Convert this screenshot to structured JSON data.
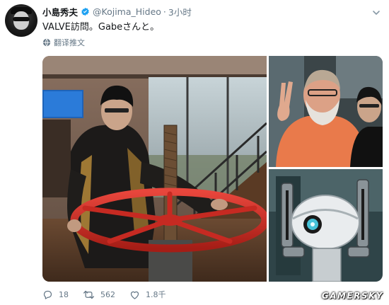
{
  "tweet": {
    "display_name": "小島秀夫",
    "handle": "@Kojima_Hideo",
    "separator": "·",
    "time": "3小时",
    "text": "VALVE訪問。Gabeさんと。",
    "translate_label": "翻译推文"
  },
  "stats": {
    "replies": "18",
    "retweets": "562",
    "likes": "1.8千"
  },
  "icons": {
    "verified": "verified-badge-icon",
    "caret": "chevron-down-icon",
    "translate": "globe-icon",
    "reply": "reply-icon",
    "retweet": "retweet-icon",
    "like": "heart-icon"
  },
  "colors": {
    "verified": "#1da1f2",
    "secondary_text": "#657786",
    "valve_wheel": "#d9302a"
  },
  "watermark": "GAMERSKY"
}
